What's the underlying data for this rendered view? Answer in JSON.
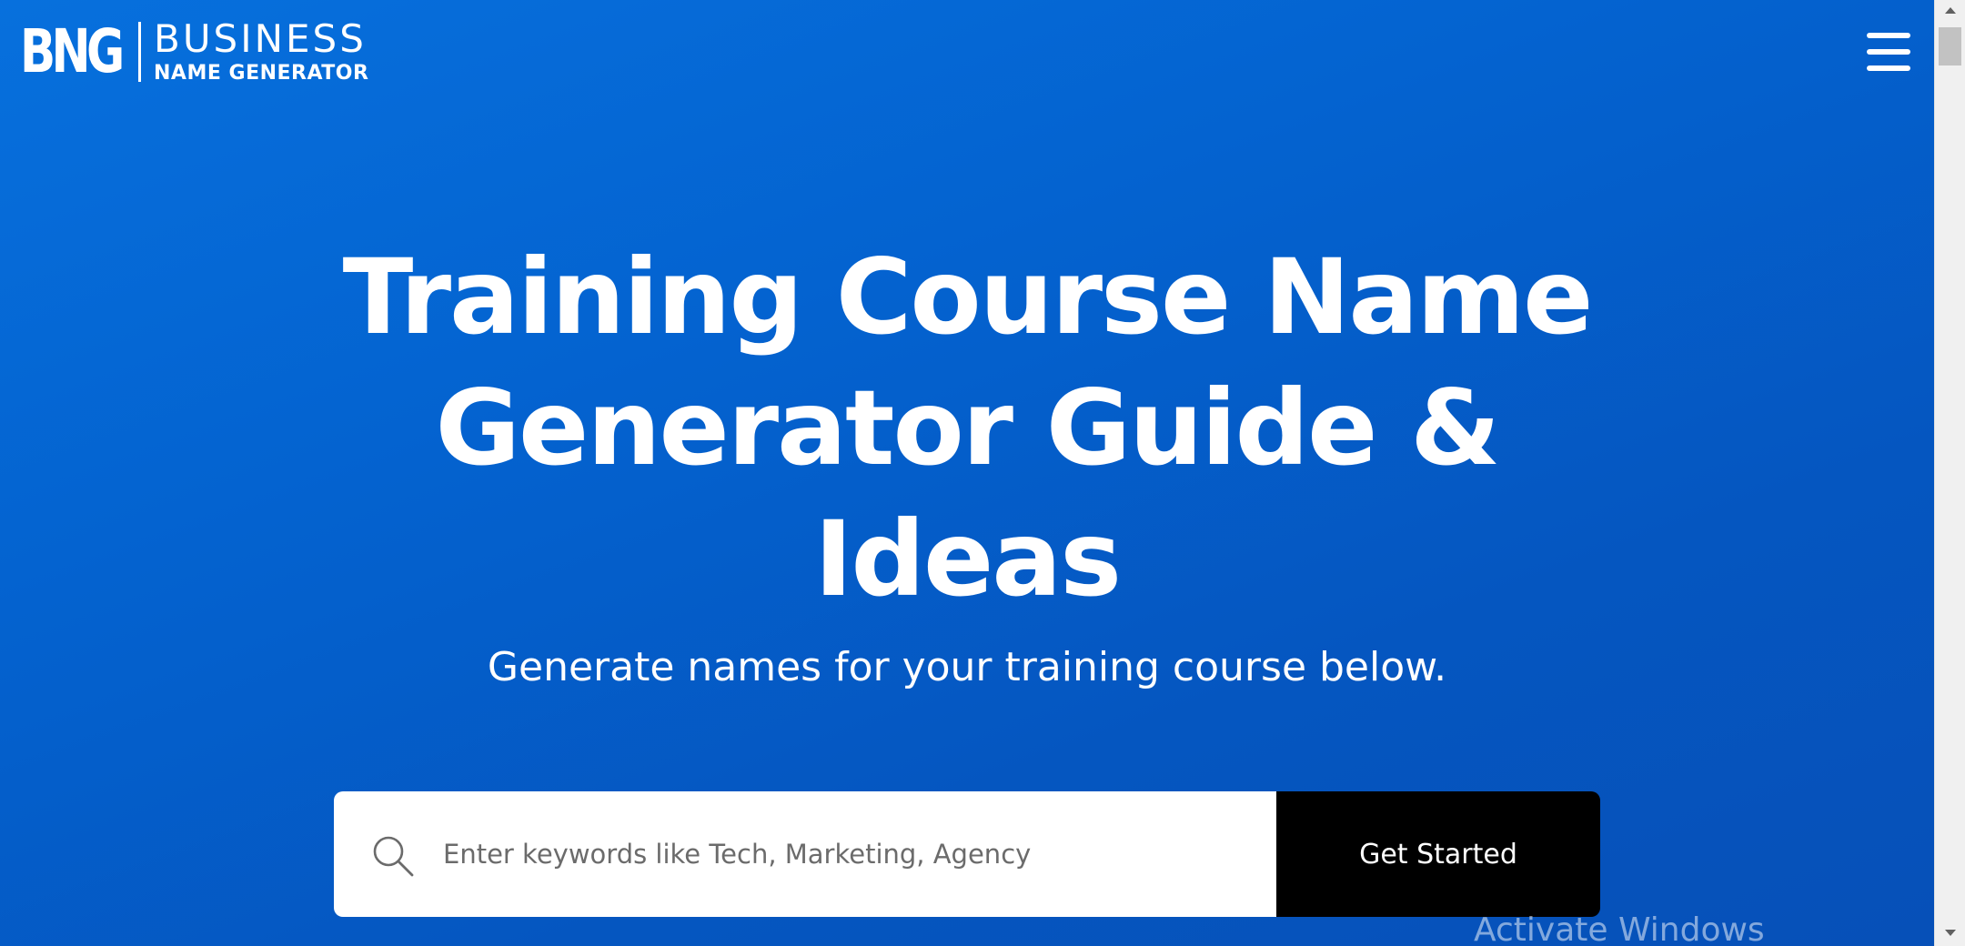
{
  "header": {
    "logo_mark": "BNG",
    "logo_line1": "BUSINESS",
    "logo_line2": "NAME GENERATOR",
    "menu_icon": "hamburger-menu-icon"
  },
  "hero": {
    "title_lines": [
      "Training Course Name",
      "Generator Guide &",
      "Ideas"
    ],
    "subtitle": "Generate names for your training course below."
  },
  "search": {
    "icon": "search-icon",
    "placeholder": "Enter keywords like Tech, Marketing, Agency",
    "value": "",
    "button_label": "Get Started"
  },
  "overlay": {
    "watermark": "Activate Windows"
  },
  "colors": {
    "hero_gradient_start": "#0770dd",
    "hero_gradient_end": "#0650b8",
    "button_bg": "#000000",
    "text": "#ffffff"
  }
}
